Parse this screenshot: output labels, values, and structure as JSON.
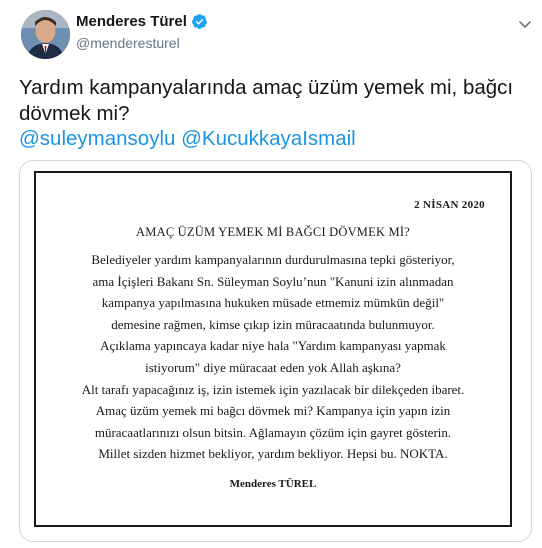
{
  "tweet": {
    "display_name": "Menderes Türel",
    "handle": "@menderesturel",
    "text_line1": "Yardım kampanyalarında amaç üzüm yemek mi, bağcı",
    "text_line2": "dövmek mi?",
    "mentions": [
      "@suleymansoylu",
      "@KucukkayaIsmail"
    ]
  },
  "document": {
    "date": "2 NİSAN 2020",
    "heading": "AMAÇ ÜZÜM YEMEK Mİ BAĞCI DÖVMEK Mİ?",
    "lines": [
      "Belediyeler yardım kampanyalarının durdurulmasına tepki gösteriyor,",
      "ama İçişleri Bakanı Sn. Süleyman Soylu’nun \"Kanuni izin alınmadan",
      "kampanya yapılmasına hukuken müsade etmemiz mümkün değil\"",
      "demesine rağmen, kimse çıkıp izin müracaatında bulunmuyor.",
      "Açıklama yapıncaya kadar niye hala \"Yardım kampanyası yapmak",
      "istiyorum\"  diye müracaat eden yok Allah aşkına?",
      "Alt tarafı yapacağınız iş, izin istemek için yazılacak bir dilekçeden ibaret.",
      "Amaç üzüm yemek mi bağcı dövmek mi? Kampanya için yapın izin",
      "müracaatlarınızı olsun bitsin. Ağlamayın çözüm için gayret gösterin.",
      "Millet sizden hizmet bekliyor, yardım bekliyor. Hepsi bu. NOKTA."
    ],
    "signature": "Menderes TÜREL"
  },
  "icons": [
    "avatar",
    "verified-badge-icon",
    "chevron-down-icon"
  ],
  "colors": {
    "link": "#1b95e0",
    "verified": "#1da1f2",
    "secondary_text": "#657786"
  }
}
